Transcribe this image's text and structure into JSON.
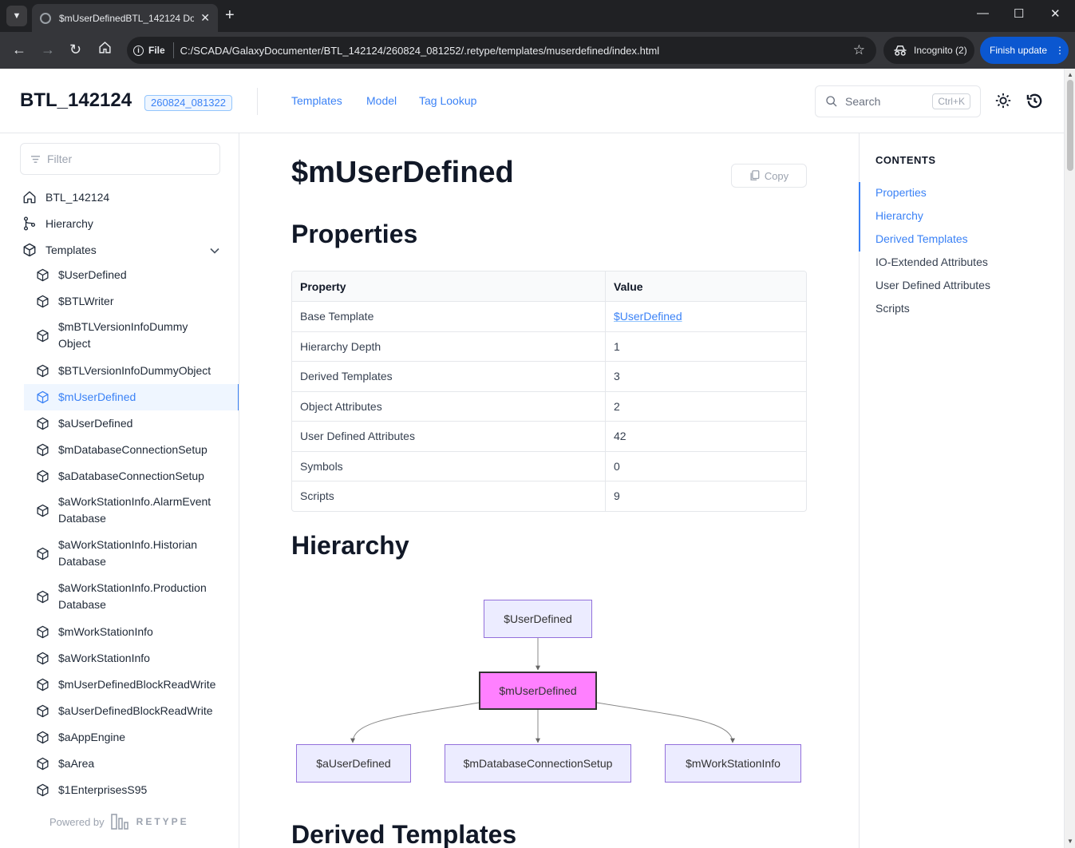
{
  "browser": {
    "tab_title": "$mUserDefinedBTL_142124 Doc",
    "file_label": "File",
    "url": "C:/SCADA/GalaxyDocumenter/BTL_142124/260824_081252/.retype/templates/muserdefined/index.html",
    "incognito_label": "Incognito (2)",
    "update_label": "Finish update"
  },
  "header": {
    "logo": "BTL_142124",
    "version": "260824_081322",
    "nav": [
      "Templates",
      "Model",
      "Tag Lookup"
    ],
    "search_placeholder": "Search",
    "search_shortcut": "Ctrl+K"
  },
  "sidebar": {
    "filter_placeholder": "Filter",
    "top_items": [
      "BTL_142124",
      "Hierarchy",
      "Templates"
    ],
    "templates": [
      "$UserDefined",
      "$BTLWriter",
      "$mBTLVersionInfoDummy\nObject",
      "$BTLVersionInfoDummyObject",
      "$mUserDefined",
      "$aUserDefined",
      "$mDatabaseConnectionSetup",
      "$aDatabaseConnectionSetup",
      "$aWorkStationInfo.AlarmEvent\nDatabase",
      "$aWorkStationInfo.Historian\nDatabase",
      "$aWorkStationInfo.Production\nDatabase",
      "$mWorkStationInfo",
      "$aWorkStationInfo",
      "$mUserDefinedBlockReadWrite",
      "$aUserDefinedBlockReadWrite",
      "$aAppEngine",
      "$aArea",
      "$1EnterprisesS95"
    ],
    "active_index": 4,
    "powered_by": "Powered by",
    "powered_brand": "RETYPE"
  },
  "main": {
    "title": "$mUserDefined",
    "copy_label": "Copy",
    "properties_heading": "Properties",
    "table": {
      "headers": [
        "Property",
        "Value"
      ],
      "rows": [
        [
          "Base Template",
          "$UserDefined"
        ],
        [
          "Hierarchy Depth",
          "1"
        ],
        [
          "Derived Templates",
          "3"
        ],
        [
          "Object Attributes",
          "2"
        ],
        [
          "User Defined Attributes",
          "42"
        ],
        [
          "Symbols",
          "0"
        ],
        [
          "Scripts",
          "9"
        ]
      ]
    },
    "hierarchy_heading": "Hierarchy",
    "diagram": {
      "parent": "$UserDefined",
      "current": "$mUserDefined",
      "children": [
        "$aUserDefined",
        "$mDatabaseConnectionSetup",
        "$mWorkStationInfo"
      ],
      "current_color": "#ff80ff",
      "node_color": "#ececff"
    },
    "derived_heading": "Derived Templates"
  },
  "toc": {
    "title": "CONTENTS",
    "items": [
      "Properties",
      "Hierarchy",
      "Derived Templates",
      "IO-Extended Attributes",
      "User Defined Attributes",
      "Scripts"
    ],
    "active_count": 3
  },
  "colors": {
    "accent": "#3b82f6",
    "update_button": "#0b57d0"
  }
}
